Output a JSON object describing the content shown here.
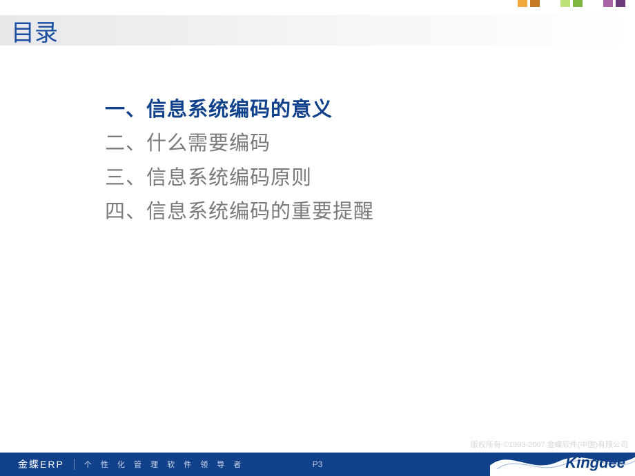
{
  "decor_colors": {
    "group1": [
      "#f0a93a",
      "#c47a1e"
    ],
    "group2": [
      "#bde077",
      "#7fb641"
    ],
    "group3": [
      "#a865a8",
      "#6d3a7b"
    ]
  },
  "title": "目录",
  "toc": [
    {
      "text": "一、信息系统编码的意义",
      "active": true
    },
    {
      "text": "二、什么需要编码",
      "active": false
    },
    {
      "text": "三、信息系统编码原则",
      "active": false
    },
    {
      "text": "四、信息系统编码的重要提醒",
      "active": false
    }
  ],
  "copyright": "版权所有 ©1993-2007 金蝶软件(中国)有限公司",
  "footer": {
    "brand": "金蝶ERP",
    "tagline": "个 性 化 管 理 软 件 领 导 者",
    "page": "P3",
    "logo": "Kingdee"
  }
}
